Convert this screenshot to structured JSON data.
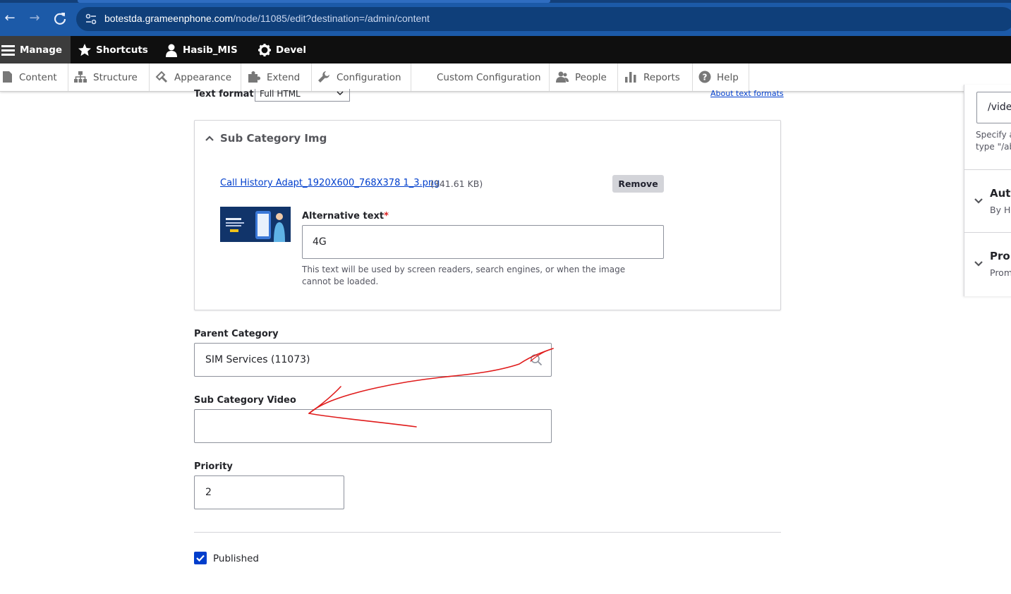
{
  "browser": {
    "url_host": "botestda.grameenphone.com",
    "url_path": "/node/11085/edit?destination=/admin/content"
  },
  "toolbar": {
    "manage": "Manage",
    "shortcuts": "Shortcuts",
    "user": "Hasib_MIS",
    "devel": "Devel"
  },
  "tray": {
    "items": [
      "Content",
      "Structure",
      "Appearance",
      "Extend",
      "Configuration",
      "Custom Configuration",
      "People",
      "Reports",
      "Help"
    ]
  },
  "text_format": {
    "label": "Text format",
    "value": "Full HTML",
    "link": "About text formats"
  },
  "sub_category_img": {
    "title": "Sub Category Img",
    "file_name": "Call History Adapt_1920X600_768X378 1_3.png",
    "file_size": "(341.61 KB)",
    "remove_label": "Remove",
    "alt_label": "Alternative text",
    "alt_required_mark": "*",
    "alt_value": "4G",
    "alt_help": "This text will be used by screen readers, search engines, or when the image cannot be loaded."
  },
  "parent_category": {
    "label": "Parent Category",
    "value": "SIM Services (11073)"
  },
  "sub_category_video": {
    "label": "Sub Category Video",
    "value": ""
  },
  "priority": {
    "label": "Priority",
    "value": "2"
  },
  "published": {
    "label": "Published",
    "checked": true
  },
  "sidebar": {
    "url_alias_value": "/vide",
    "url_alias_help_1": "Specify a",
    "url_alias_help_2": "type \"/ab",
    "authoring_title": "Auth",
    "authoring_summary": "By H",
    "promotion_title": "Pron",
    "promotion_summary": "Prom"
  },
  "colors": {
    "browser_chrome": "#1c5aa8",
    "toolbar_black": "#0f0f0f",
    "link_blue": "#003ecc",
    "required_red": "#dc2323",
    "annotation_red": "#e01b1b"
  }
}
